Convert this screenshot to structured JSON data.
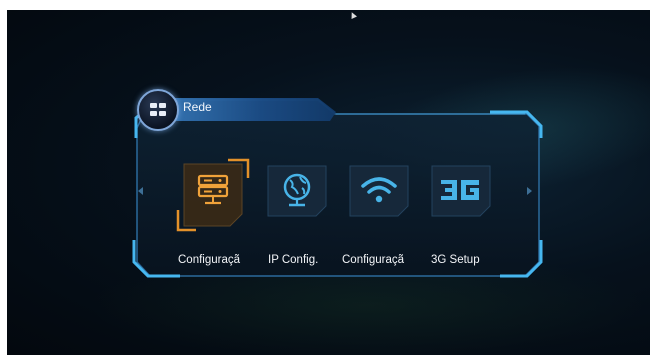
{
  "window": {
    "title": "Rede"
  },
  "tiles": [
    {
      "label": "Configuraçã",
      "icon": "server-icon",
      "selected": true
    },
    {
      "label": "IP Config.",
      "icon": "globe-icon",
      "selected": false
    },
    {
      "label": "Configuraçã",
      "icon": "wifi-icon",
      "selected": false
    },
    {
      "label": "3G Setup",
      "icon": "3g-icon",
      "selected": false
    }
  ],
  "colors": {
    "accent": "#e3912a",
    "frame": "#3fa8e0",
    "tile": "#16283a"
  }
}
